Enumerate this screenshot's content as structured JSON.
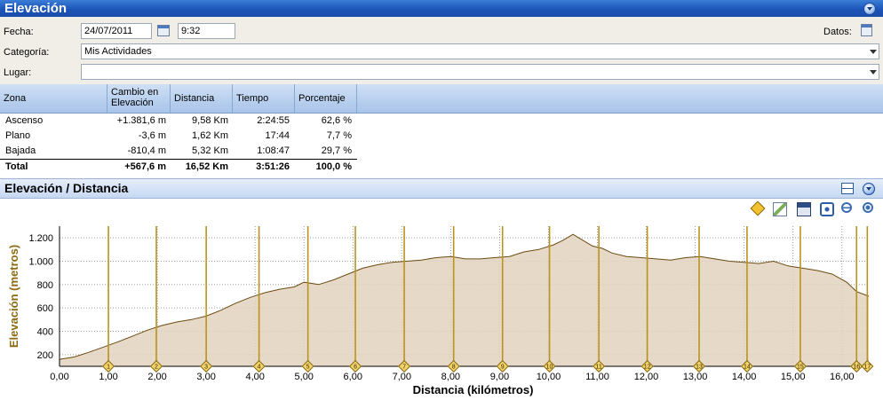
{
  "window": {
    "title": "Elevación"
  },
  "form": {
    "fecha_label": "Fecha:",
    "fecha_value": "24/07/2011",
    "hora_value": "9:32",
    "datos_label": "Datos:",
    "categoria_label": "Categoría:",
    "categoria_value": "Mis Actividades",
    "lugar_label": "Lugar:",
    "lugar_value": ""
  },
  "table": {
    "headers": [
      "Zona",
      "Cambio en Elevación",
      "Distancia",
      "Tiempo",
      "Porcentaje"
    ],
    "rows": [
      [
        "Ascenso",
        "+1.381,6 m",
        "9,58 Km",
        "2:24:55",
        "62,6 %"
      ],
      [
        "Plano",
        "-3,6 m",
        "1,62 Km",
        "17:44",
        "7,7 %"
      ],
      [
        "Bajada",
        "-810,4 m",
        "5,32 Km",
        "1:08:47",
        "29,7 %"
      ],
      [
        "Total",
        "+567,6 m",
        "16,52 Km",
        "3:51:26",
        "100,0 %"
      ]
    ]
  },
  "chart_section": {
    "title": "Elevación / Distancia"
  },
  "colors": {
    "accent": "#1b55b8",
    "fill": "#e2d2bd",
    "line": "#6b4a12",
    "marker": "#b8941e",
    "axis_label": "#8a6a10"
  },
  "chart_data": {
    "type": "area",
    "xlabel": "Distancia (kilómetros)",
    "ylabel": "Elevación (metros)",
    "xlim": [
      0,
      16.55
    ],
    "ylim": [
      100,
      1300
    ],
    "xticks": [
      "0,00",
      "1,00",
      "2,00",
      "3,00",
      "4,00",
      "5,00",
      "6,00",
      "7,00",
      "8,00",
      "9,00",
      "10,00",
      "11,00",
      "12,00",
      "13,00",
      "14,00",
      "15,00",
      "16,00"
    ],
    "yticks": [
      "200",
      "400",
      "600",
      "800",
      "1.000",
      "1.200"
    ],
    "grid": true,
    "x": [
      0,
      0.3,
      0.6,
      0.9,
      1.2,
      1.5,
      1.8,
      2.1,
      2.4,
      2.7,
      3.0,
      3.3,
      3.6,
      3.9,
      4.2,
      4.5,
      4.8,
      5.0,
      5.3,
      5.6,
      5.9,
      6.2,
      6.5,
      6.8,
      7.1,
      7.4,
      7.7,
      8.0,
      8.3,
      8.6,
      8.9,
      9.2,
      9.5,
      9.8,
      10.1,
      10.3,
      10.5,
      10.7,
      10.9,
      11.1,
      11.3,
      11.6,
      11.9,
      12.2,
      12.5,
      12.8,
      13.1,
      13.4,
      13.7,
      14.0,
      14.3,
      14.6,
      14.9,
      15.2,
      15.5,
      15.8,
      16.1,
      16.3,
      16.55
    ],
    "y": [
      160,
      180,
      220,
      265,
      310,
      360,
      410,
      450,
      480,
      500,
      530,
      580,
      640,
      690,
      730,
      760,
      780,
      820,
      800,
      840,
      890,
      940,
      970,
      990,
      1000,
      1010,
      1030,
      1040,
      1020,
      1020,
      1030,
      1040,
      1080,
      1100,
      1140,
      1180,
      1230,
      1180,
      1130,
      1110,
      1070,
      1040,
      1030,
      1020,
      1010,
      1030,
      1040,
      1020,
      1000,
      990,
      980,
      1000,
      960,
      940,
      920,
      890,
      820,
      740,
      700
    ],
    "markers": [
      "1",
      "2",
      "3",
      "4",
      "5",
      "6",
      "7",
      "8",
      "9",
      "10",
      "11",
      "12",
      "13",
      "14",
      "15",
      "16",
      "17"
    ],
    "marker_x": [
      1.0,
      1.98,
      3.0,
      4.08,
      5.08,
      6.05,
      7.05,
      8.06,
      9.06,
      10.02,
      11.03,
      12.02,
      13.08,
      14.06,
      15.15,
      16.3,
      16.52
    ]
  }
}
